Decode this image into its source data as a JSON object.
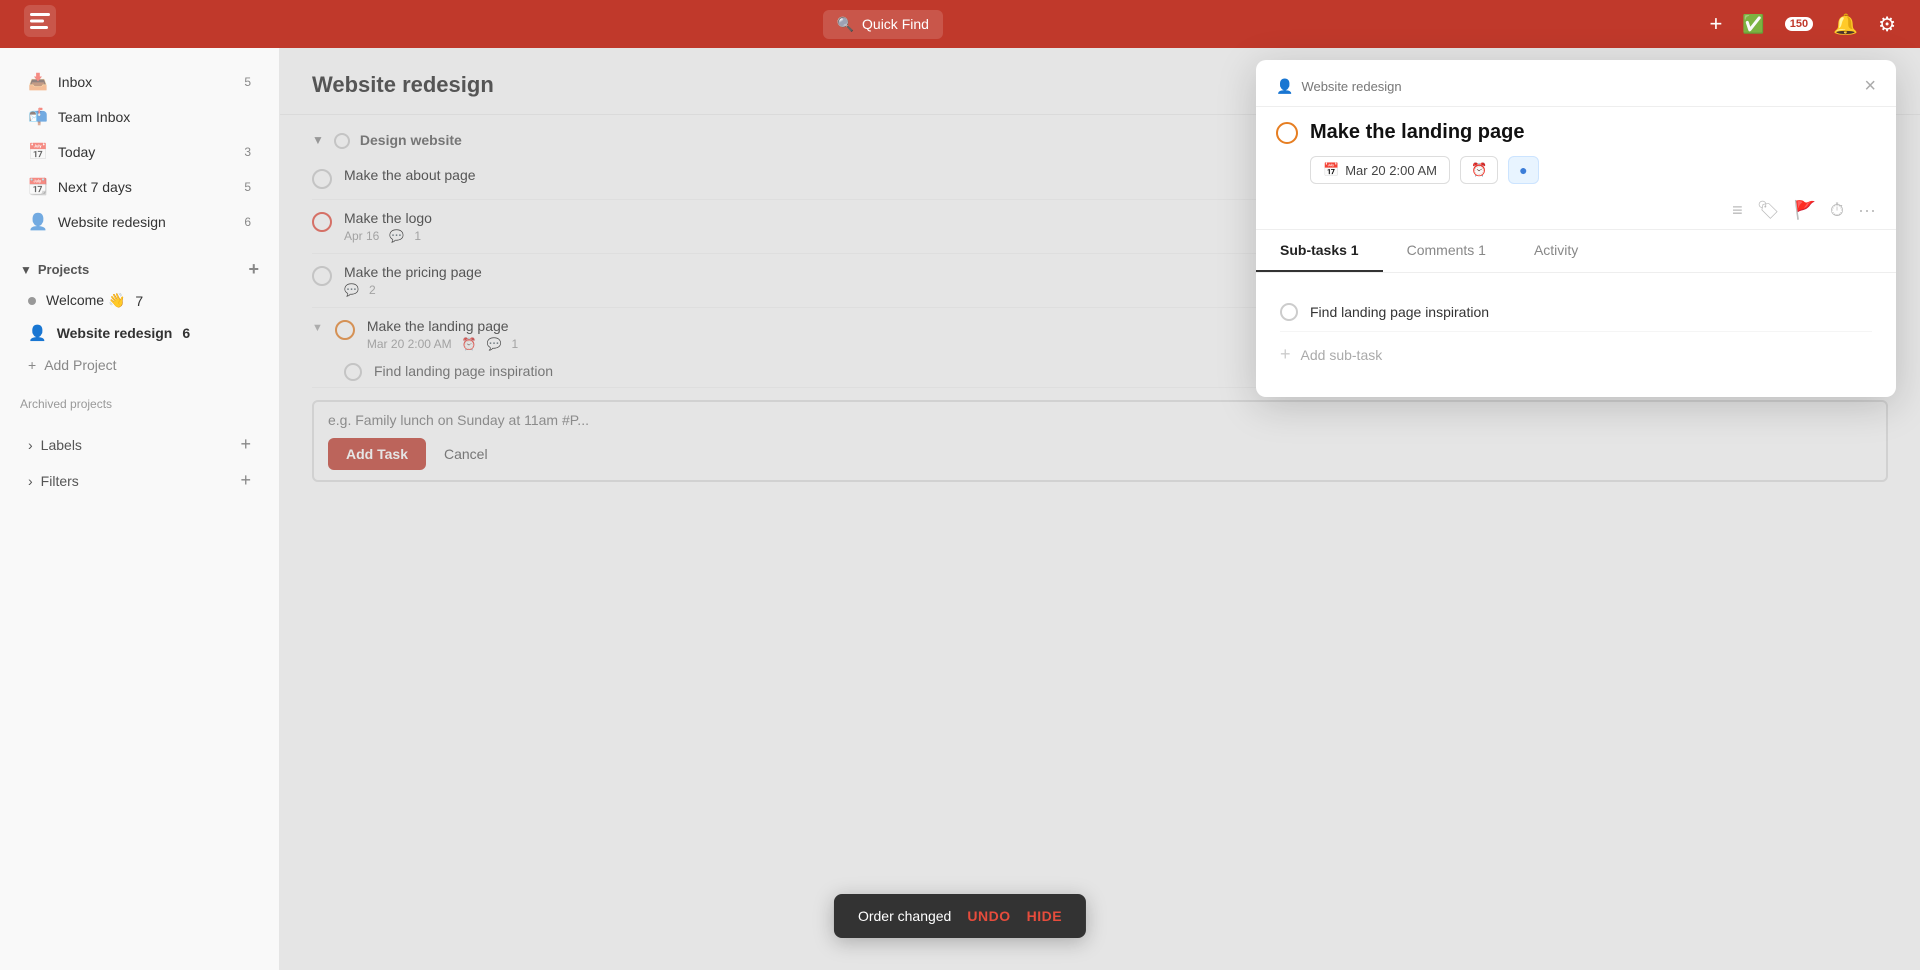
{
  "topnav": {
    "logo": "☰",
    "search_placeholder": "Quick Find",
    "count": "150",
    "add_label": "+",
    "notif_label": "🔔",
    "settings_label": "⚙"
  },
  "sidebar": {
    "items": [
      {
        "label": "Inbox",
        "badge": "5",
        "icon": "📥"
      },
      {
        "label": "Team Inbox",
        "badge": "",
        "icon": "📬"
      },
      {
        "label": "Today",
        "badge": "3",
        "icon": "📅"
      },
      {
        "label": "Next 7 days",
        "badge": "5",
        "icon": "📆"
      },
      {
        "label": "Website redesign",
        "badge": "6",
        "icon": "👤"
      }
    ],
    "projects_label": "Projects",
    "projects": [
      {
        "label": "Welcome 👋",
        "badge": "7",
        "dot": "grey"
      },
      {
        "label": "Website redesign",
        "badge": "6",
        "dot": "blue",
        "active": true
      }
    ],
    "add_project_label": "Add Project",
    "archived_label": "Archived projects",
    "labels_label": "Labels",
    "filters_label": "Filters"
  },
  "main": {
    "title": "Website redesign",
    "group_label": "Design website",
    "tasks": [
      {
        "title": "Make the about page",
        "circle": "normal",
        "meta": []
      },
      {
        "title": "Make the logo",
        "circle": "red",
        "date": "Apr 16",
        "comment_count": "1"
      },
      {
        "title": "Make the pricing page",
        "circle": "normal",
        "comment_count": "2"
      },
      {
        "title": "Make the landing page",
        "circle": "orange",
        "date": "Mar 20 2:00 AM",
        "comment_count": "1",
        "expanded": true
      }
    ],
    "subtask_label": "Find landing page inspiration",
    "input_placeholder": "e.g. Family lunch on Sunday at 11am #P...",
    "add_task_label": "Add Task",
    "cancel_label": "Cancel"
  },
  "panel": {
    "project_name": "Website redesign",
    "close_label": "×",
    "title": "Make the landing page",
    "date_label": "Mar 20 2:00 AM",
    "tabs": [
      {
        "label": "Sub-tasks 1",
        "active": true
      },
      {
        "label": "Comments 1",
        "active": false
      },
      {
        "label": "Activity",
        "active": false
      }
    ],
    "subtasks": [
      {
        "label": "Find landing page inspiration"
      }
    ],
    "add_subtask_label": "Add sub-task"
  },
  "toast": {
    "message": "Order changed",
    "undo_label": "UNDO",
    "hide_label": "HIDE"
  }
}
